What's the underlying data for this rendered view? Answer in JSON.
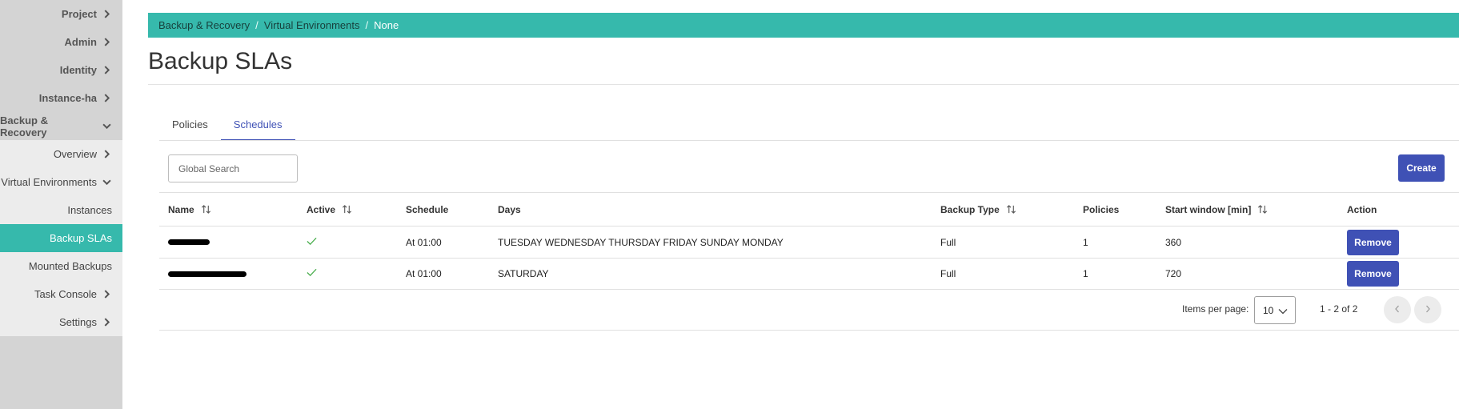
{
  "sidebar": {
    "items": [
      {
        "label": "Project",
        "icon": "chevron-right-icon"
      },
      {
        "label": "Admin",
        "icon": "chevron-right-icon"
      },
      {
        "label": "Identity",
        "icon": "chevron-right-icon"
      },
      {
        "label": "Instance-ha",
        "icon": "chevron-right-icon"
      },
      {
        "label": "Backup & Recovery",
        "icon": "chevron-down-icon"
      },
      {
        "label": "Overview",
        "icon": "chevron-right-icon"
      },
      {
        "label": "Virtual Environments",
        "icon": "chevron-down-icon"
      },
      {
        "label": "Instances"
      },
      {
        "label": "Backup SLAs"
      },
      {
        "label": "Mounted Backups"
      },
      {
        "label": "Task Console",
        "icon": "chevron-right-icon"
      },
      {
        "label": "Settings",
        "icon": "chevron-right-icon"
      }
    ]
  },
  "breadcrumb": {
    "items": [
      "Backup & Recovery",
      "Virtual Environments",
      "None"
    ],
    "separator": "/"
  },
  "page": {
    "title": "Backup SLAs"
  },
  "tabs": [
    {
      "label": "Policies",
      "active": false
    },
    {
      "label": "Schedules",
      "active": true
    }
  ],
  "search": {
    "placeholder": "Global Search",
    "value": ""
  },
  "toolbar": {
    "create_label": "Create"
  },
  "table": {
    "columns": [
      "Name",
      "Active",
      "Schedule",
      "Days",
      "Backup Type",
      "Policies",
      "Start window [min]",
      "Action"
    ],
    "rows": [
      {
        "name": "[redacted]",
        "active": true,
        "schedule": "At 01:00",
        "days": "TUESDAY WEDNESDAY THURSDAY FRIDAY SUNDAY MONDAY",
        "backup_type": "Full",
        "policies": "1",
        "start_window": "360",
        "action": "Remove"
      },
      {
        "name": "[redacted]",
        "active": true,
        "schedule": "At 01:00",
        "days": "SATURDAY",
        "backup_type": "Full",
        "policies": "1",
        "start_window": "720",
        "action": "Remove"
      }
    ]
  },
  "paginator": {
    "items_per_page_label": "Items per page:",
    "items_per_page": "10",
    "range_label": "1 - 2 of 2"
  },
  "colors": {
    "accent": "#36b9ac",
    "primary": "#3f51b5",
    "sidebar_bg": "#d4d4d4",
    "sidebar_sub_bg": "#ececec",
    "check": "#4caf50"
  }
}
